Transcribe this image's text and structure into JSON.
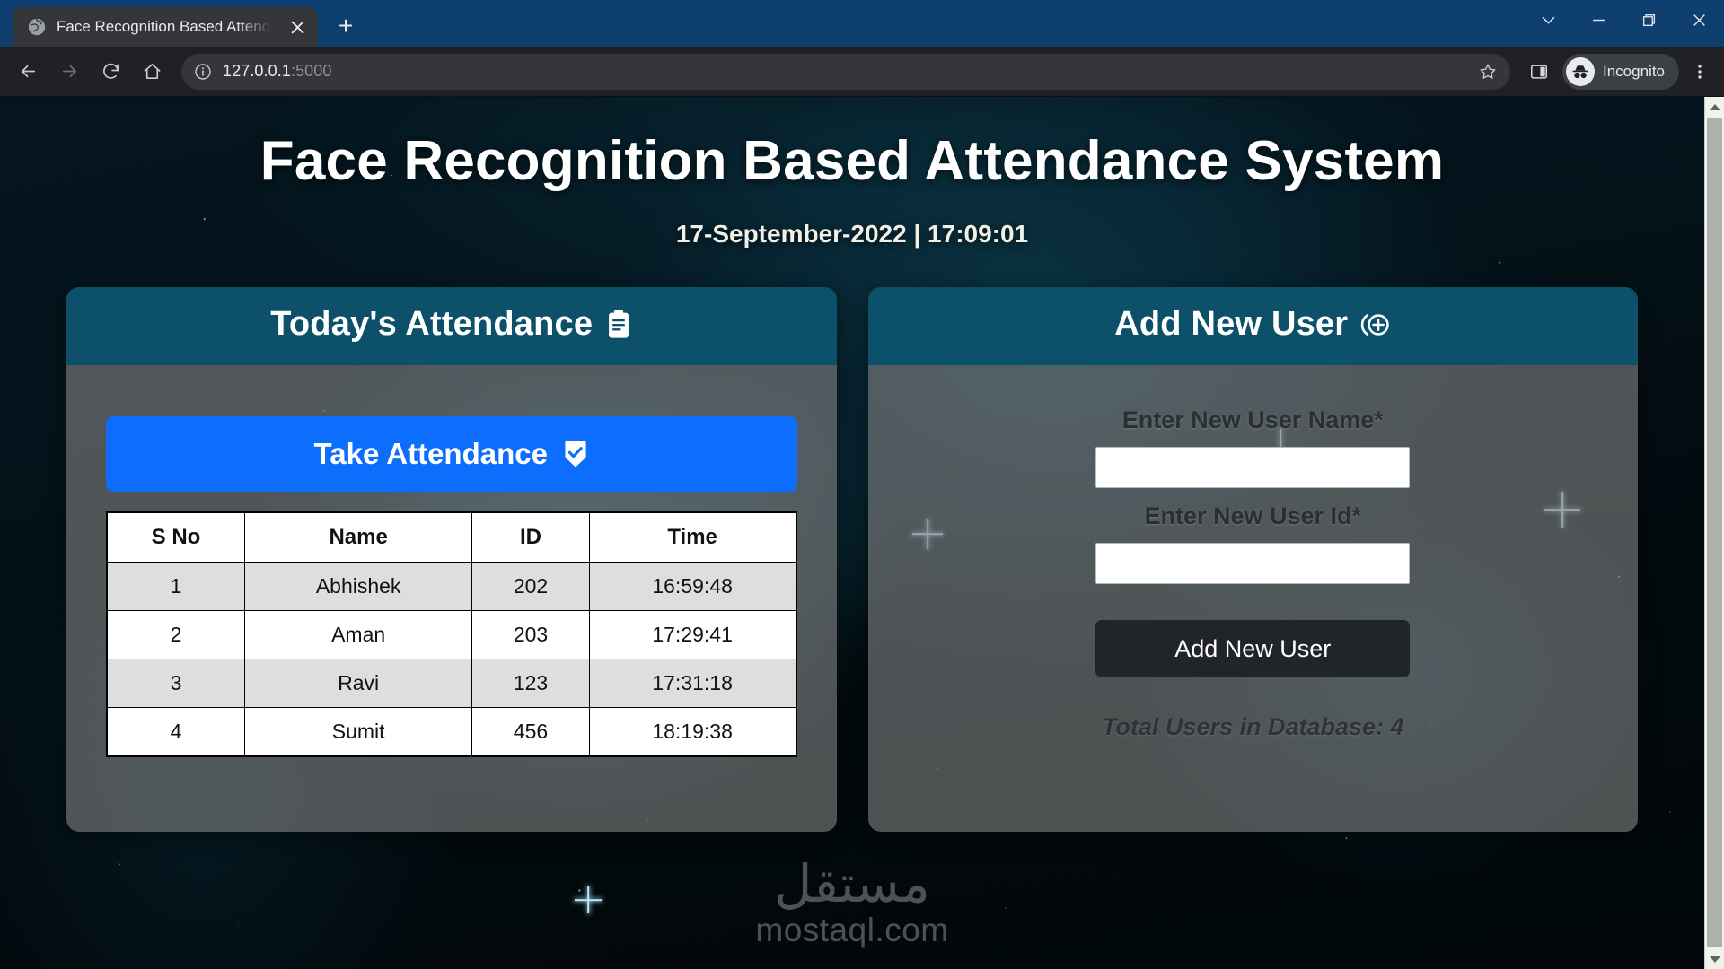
{
  "browser": {
    "tab": {
      "title": "Face Recognition Based Attendan",
      "favicon_icon": "globe-icon",
      "close_icon": "close-icon"
    },
    "new_tab_label": "+",
    "window_controls": {
      "chevron_down": "chevron-down-icon",
      "minimize": "minimize-icon",
      "maximize": "maximize-icon",
      "close": "close-icon"
    },
    "toolbar": {
      "back_icon": "back-arrow-icon",
      "forward_icon": "forward-arrow-icon",
      "reload_icon": "reload-icon",
      "home_icon": "home-icon",
      "info_icon": "info-circle-icon",
      "url_host": "127.0.0.1",
      "url_port": ":5000",
      "url_full": "127.0.0.1:5000",
      "star_icon": "bookmark-star-icon",
      "side_panel_icon": "side-panel-icon",
      "incognito_icon": "incognito-icon",
      "incognito_label": "Incognito",
      "menu_icon": "kebab-menu-icon"
    }
  },
  "page": {
    "title": "Face Recognition Based Attendance System",
    "datetime": "17-September-2022 | 17:09:01",
    "attendance_panel": {
      "heading": "Today's Attendance",
      "heading_icon": "clipboard-icon",
      "take_attendance_label": "Take Attendance",
      "take_attendance_icon": "shield-check-icon",
      "table": {
        "columns": [
          "S No",
          "Name",
          "ID",
          "Time"
        ],
        "rows": [
          [
            "1",
            "Abhishek",
            "202",
            "16:59:48"
          ],
          [
            "2",
            "Aman",
            "203",
            "17:29:41"
          ],
          [
            "3",
            "Ravi",
            "123",
            "17:31:18"
          ],
          [
            "4",
            "Sumit",
            "456",
            "18:19:38"
          ]
        ]
      }
    },
    "add_user_panel": {
      "heading": "Add New User",
      "heading_icon": "person-add-circle-icon",
      "name_label": "Enter New User Name*",
      "name_value": "",
      "id_label": "Enter New User Id*",
      "id_value": "",
      "submit_label": "Add New User",
      "total_users_text": "Total Users in Database: 4"
    },
    "watermark": {
      "arabic": "مستقل",
      "latin": "mostaql.com"
    }
  },
  "colors": {
    "card_header_teal": "#0c5169",
    "primary_blue": "#0d6efd",
    "dark_button": "#212529",
    "card_body_gray": "#808080",
    "titlebar_blue": "#0f3f6e",
    "toolbar_dark": "#202124"
  }
}
